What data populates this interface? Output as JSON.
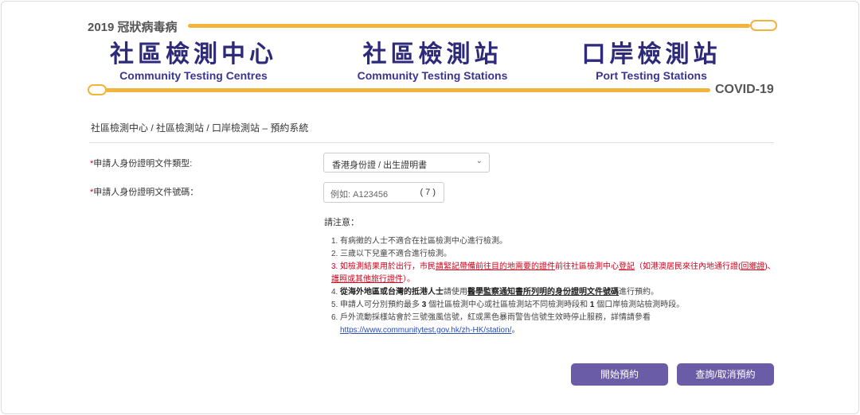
{
  "banner": {
    "year_label": "2019 冠狀病毒病",
    "covid_label": "COVID-19",
    "titles": [
      {
        "zh": "社區檢測中心",
        "en": "Community Testing Centres"
      },
      {
        "zh": "社區檢測站",
        "en": "Community Testing Stations"
      },
      {
        "zh": "口岸檢測站",
        "en": "Port Testing Stations"
      }
    ]
  },
  "breadcrumb": "社區檢測中心 / 社區檢測站 / 口岸檢測站 – 預約系統",
  "form": {
    "required_mark": "*",
    "doc_type_label": "申請人身份證明文件類型:",
    "doc_type_value": "香港身份證 / 出生證明書",
    "doc_no_label": "申請人身份證明文件號碼：",
    "doc_no_placeholder": "例如: A123456",
    "check_digit_placeholder": "( 7 )"
  },
  "notes": {
    "title": "請注意：",
    "items": {
      "1": "有病徵的人士不適合在社區檢測中心進行檢測。",
      "2": "三歲以下兒童不適合進行檢測。",
      "3a": "如檢測結果用於出行，市民",
      "3b": "請緊記帶備前往目的地需要的證件",
      "3c": "前往社區檢測中心",
      "3d": "登記",
      "3e": "（如港澳居民來往內地通行證(",
      "3f": "回鄉證",
      "3g": ")、",
      "3h": "護照或其他旅行證件",
      "3i": "）。",
      "4a": "從海外地區或台灣的抵港人士",
      "4b": "請使用",
      "4c": "醫學監察通知書所列明的身份證明文件號碼",
      "4d": "進行預約。",
      "5a": "申請人可分別預約最多 ",
      "5b": "3",
      "5c": " 個社區檢測中心或社區檢測站不同檢測時段和 ",
      "5d": "1",
      "5e": " 個口岸檢測站檢測時段。",
      "6a": "戶外流動採樣站會於三號強風信號，紅或黑色暴雨警告信號生效時停止服務，詳情請參看",
      "6b": "https://www.communitytest.gov.hk/zh-HK/station/",
      "6c": "。"
    },
    "numbers": [
      "1.",
      "2.",
      "3.",
      "4.",
      "5.",
      "6."
    ]
  },
  "buttons": {
    "start": "開始預約",
    "query": "查詢/取消預約"
  },
  "colors": {
    "accent": "#6b5ca8",
    "gold": "#f0b43c",
    "navy": "#2e2a7a",
    "red": "#d0021b"
  }
}
